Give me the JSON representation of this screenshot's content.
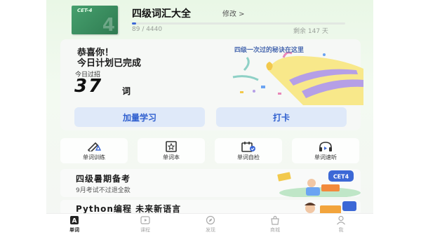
{
  "book": {
    "cover_label": "CET-4",
    "cover_number": "4",
    "title": "四级词汇大全",
    "edit": "修改 >",
    "progress": {
      "learned": 89,
      "total": 4440,
      "text": "89 / 4440"
    },
    "days_left": "剩余 147 天"
  },
  "summary": {
    "congrats": "恭喜你！",
    "plan_done": "今日计划已完成",
    "today_label": "今日过招",
    "today_count": "37",
    "today_unit": "词",
    "banner": "四级一次过的秘诀在这里"
  },
  "actions": {
    "study_more": "加量学习",
    "check_in": "打卡"
  },
  "tools": [
    {
      "label": "单词训练",
      "icon": "pen-icon"
    },
    {
      "label": "单词本",
      "icon": "star-book-icon"
    },
    {
      "label": "单词自检",
      "icon": "calendar-check-icon"
    },
    {
      "label": "单词速听",
      "icon": "headphones-icon"
    }
  ],
  "promos": [
    {
      "title": "四级暑期备考",
      "subtitle": "9月考试不过退全款",
      "badge": "CET4"
    },
    {
      "title": "Python编程 未来新语言"
    }
  ],
  "nav": [
    {
      "label": "单词",
      "icon": "word-icon",
      "active": true
    },
    {
      "label": "课程",
      "icon": "play-icon",
      "active": false
    },
    {
      "label": "发现",
      "icon": "compass-icon",
      "active": false
    },
    {
      "label": "商城",
      "icon": "shop-icon",
      "active": false
    },
    {
      "label": "我",
      "icon": "profile-icon",
      "active": false
    }
  ],
  "colors": {
    "accent": "#3c68d6",
    "button_bg": "#dfe9f9",
    "button_text": "#2f5fcf",
    "cover_green": "#2f7b51",
    "party_yellow": "#f8e88a",
    "party_purple": "#b59fe6"
  }
}
